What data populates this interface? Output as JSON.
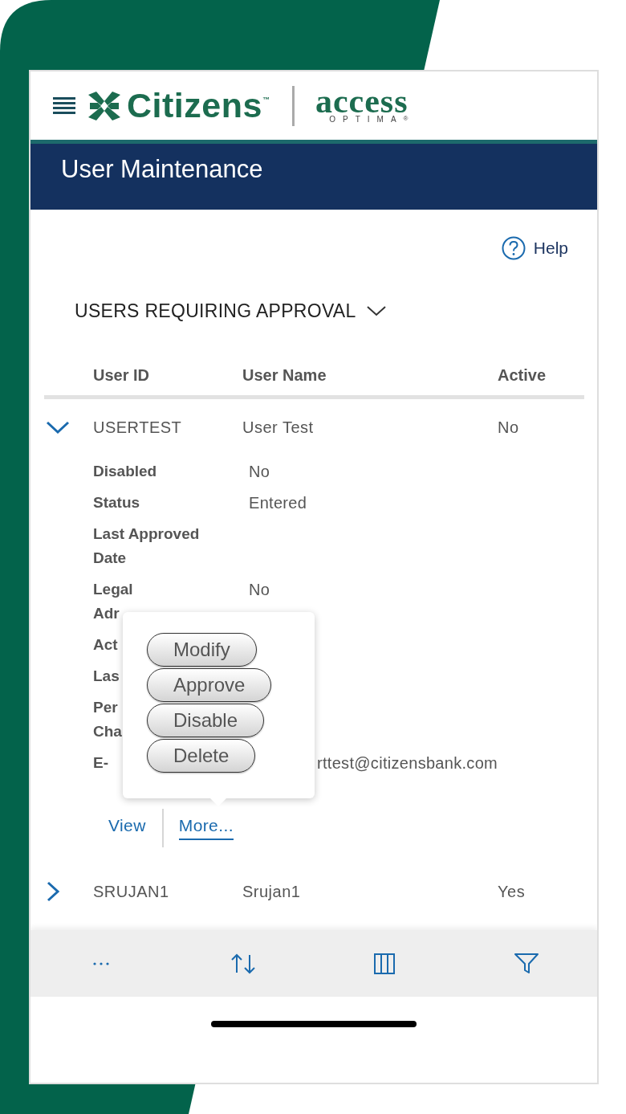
{
  "logo": {
    "brand": "Citizens",
    "trademark": "™",
    "product": "access",
    "product_sub": "OPTIMA",
    "registered": "®"
  },
  "title_bar": {
    "title": "User Maintenance"
  },
  "help": {
    "label": "Help"
  },
  "section": {
    "title": "USERS REQUIRING APPROVAL",
    "expanded": true
  },
  "table": {
    "columns": [
      "User ID",
      "User Name",
      "Active"
    ],
    "rows": [
      {
        "user_id": "USERTEST",
        "user_name": "User Test",
        "active": "No",
        "expanded": true,
        "details": [
          {
            "label": "Disabled",
            "value": "No"
          },
          {
            "label": "Status",
            "value": "Entered"
          },
          {
            "label": "Last Approved\nDate"
          },
          {
            "label": "Legal\nAdr",
            "value": "No"
          },
          {
            "label": "Act"
          },
          {
            "label": "Las"
          },
          {
            "label": "Per\nCha"
          },
          {
            "label": "E-",
            "value": "rttest@citizensbank.com"
          }
        ],
        "actions": [
          {
            "label": "View",
            "selected": false
          },
          {
            "label": "More...",
            "selected": true
          }
        ],
        "menu": [
          "Modify",
          "Approve",
          "Disable",
          "Delete"
        ]
      },
      {
        "user_id": "SRUJAN1",
        "user_name": "Srujan1",
        "active": "Yes",
        "expanded": false
      }
    ]
  }
}
